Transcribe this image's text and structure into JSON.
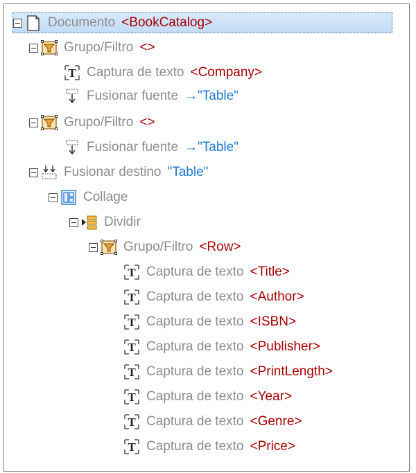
{
  "tree": {
    "nodes": [
      {
        "label": "Documento",
        "arg": "<BookCatalog>",
        "arg_style": "tag",
        "icon": "document-icon"
      },
      {
        "label": "Grupo/Filtro",
        "arg": "<>",
        "arg_style": "tag",
        "icon": "filter-icon"
      },
      {
        "label": "Captura de texto",
        "arg": "<Company>",
        "arg_style": "tag",
        "icon": "text-capture-icon"
      },
      {
        "label": "Fusionar fuente",
        "arg": "→\"Table\"",
        "arg_style": "str",
        "icon": "merge-source-icon"
      },
      {
        "label": "Grupo/Filtro",
        "arg": "<>",
        "arg_style": "tag",
        "icon": "filter-icon"
      },
      {
        "label": "Fusionar fuente",
        "arg": "→\"Table\"",
        "arg_style": "str",
        "icon": "merge-source-icon"
      },
      {
        "label": "Fusionar destino",
        "arg": "\"Table\"",
        "arg_style": "str",
        "icon": "merge-target-icon"
      },
      {
        "label": "Collage",
        "arg": "",
        "arg_style": "tag",
        "icon": "collage-icon"
      },
      {
        "label": "Dividir",
        "arg": "",
        "arg_style": "tag",
        "icon": "split-icon"
      },
      {
        "label": "Grupo/Filtro",
        "arg": "<Row>",
        "arg_style": "tag",
        "icon": "filter-icon"
      },
      {
        "label": "Captura de texto",
        "arg": "<Title>",
        "arg_style": "tag",
        "icon": "text-capture-icon"
      },
      {
        "label": "Captura de texto",
        "arg": "<Author>",
        "arg_style": "tag",
        "icon": "text-capture-icon"
      },
      {
        "label": "Captura de texto",
        "arg": "<ISBN>",
        "arg_style": "tag",
        "icon": "text-capture-icon"
      },
      {
        "label": "Captura de texto",
        "arg": "<Publisher>",
        "arg_style": "tag",
        "icon": "text-capture-icon"
      },
      {
        "label": "Captura de texto",
        "arg": "<PrintLength>",
        "arg_style": "tag",
        "icon": "text-capture-icon"
      },
      {
        "label": "Captura de texto",
        "arg": "<Year>",
        "arg_style": "tag",
        "icon": "text-capture-icon"
      },
      {
        "label": "Captura de texto",
        "arg": "<Genre>",
        "arg_style": "tag",
        "icon": "text-capture-icon"
      },
      {
        "label": "Captura de texto",
        "arg": "<Price>",
        "arg_style": "tag",
        "icon": "text-capture-icon"
      }
    ]
  },
  "colors": {
    "tag": "#a80000",
    "string": "#1a7ad4",
    "label": "#8c8c8c",
    "selection": "#c3dcf7",
    "filter_icon": "#e8a33c"
  }
}
